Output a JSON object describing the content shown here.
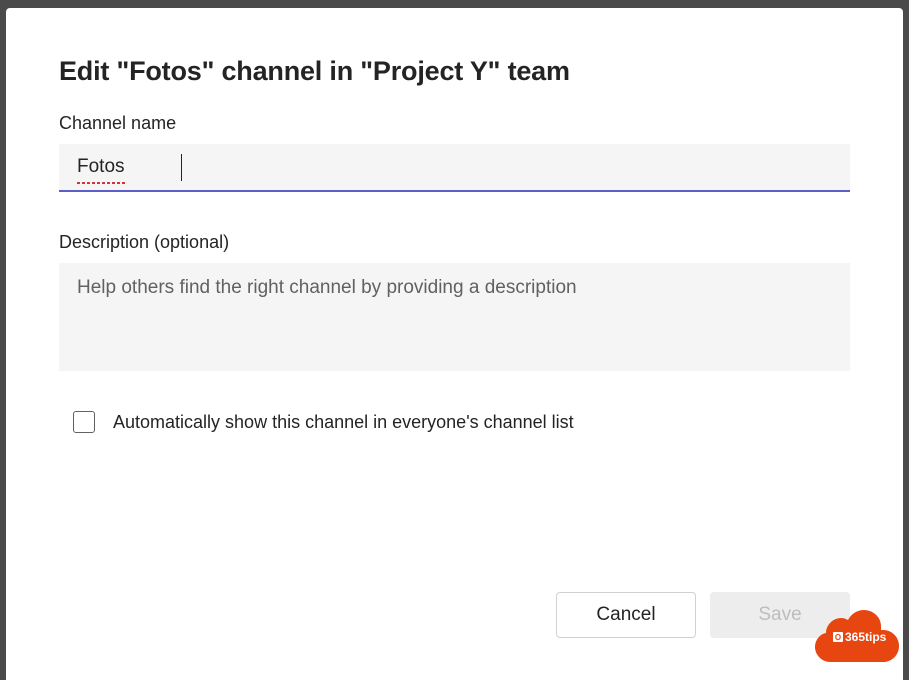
{
  "dialog": {
    "title": "Edit \"Fotos\" channel in \"Project Y\" team",
    "channelName": {
      "label": "Channel name",
      "value": "Fotos"
    },
    "description": {
      "label": "Description (optional)",
      "placeholder": "Help others find the right channel by providing a description",
      "value": ""
    },
    "autoShow": {
      "label": "Automatically show this channel in everyone's channel list",
      "checked": false
    },
    "buttons": {
      "cancel": "Cancel",
      "save": "Save"
    }
  },
  "watermark": {
    "text": "365tips"
  }
}
